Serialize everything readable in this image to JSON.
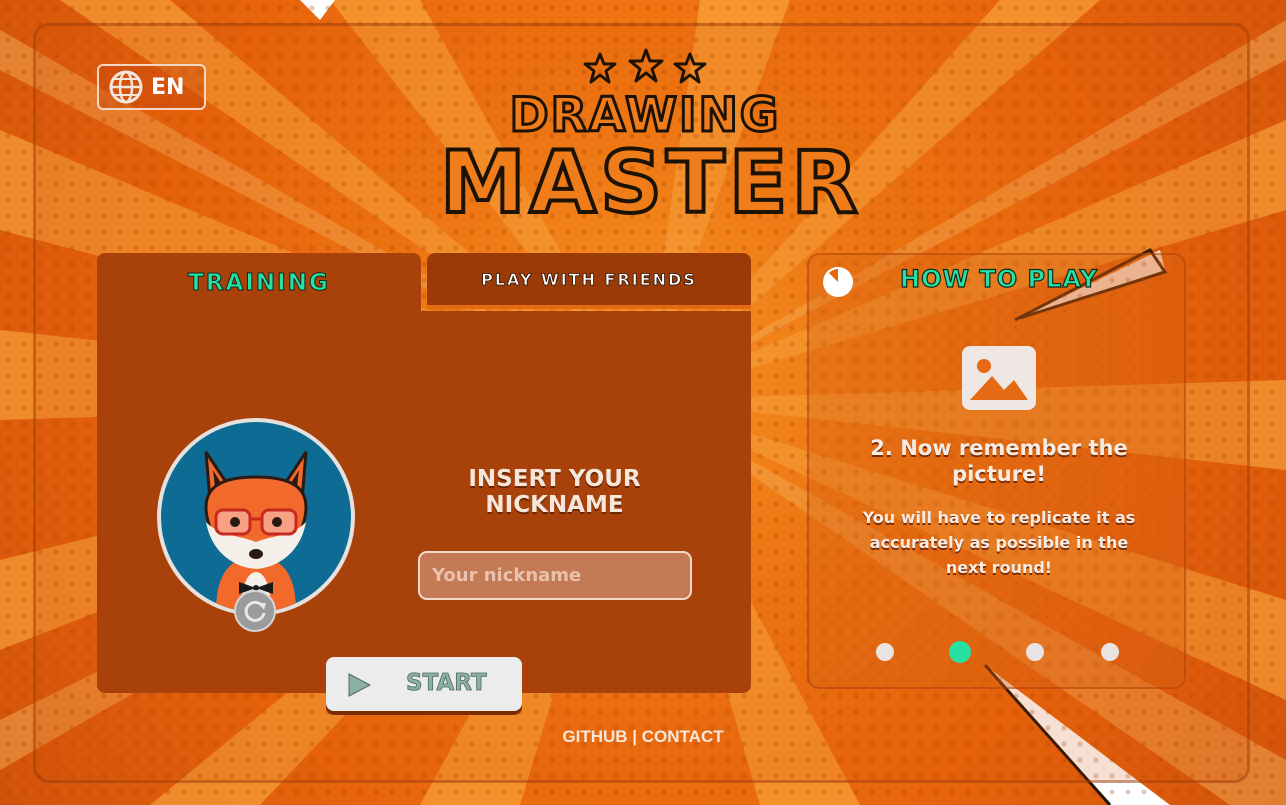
{
  "language": {
    "code": "EN",
    "icon": "globe-icon"
  },
  "logo": {
    "line1": "DRAWING",
    "line2": "MASTER",
    "stars_icon": "three-stars-icon"
  },
  "tabs": [
    {
      "label": "TRAINING",
      "active": true
    },
    {
      "label": "PLAY WITH FRIENDS",
      "active": false
    }
  ],
  "training": {
    "avatar_icon": "fox-avatar",
    "refresh_icon": "refresh-icon",
    "insert_title_line1": "INSERT YOUR",
    "insert_title_line2": "NICKNAME",
    "nickname_placeholder": "Your nickname",
    "nickname_value": "",
    "start_label": "START",
    "start_icon": "play-icon"
  },
  "how_to_play": {
    "title": "HOW TO PLAY",
    "timer_icon": "timer-icon",
    "step_icon": "image-icon",
    "step_title": "2. Now remember the picture!",
    "step_description": "You will have to replicate it as accurately as possible in the next round!",
    "total_steps": 4,
    "active_step": 2
  },
  "footer": {
    "github": "GITHUB",
    "separator": "|",
    "contact": "CONTACT"
  },
  "colors": {
    "accent": "#27e0a4",
    "panel": "#a9420a",
    "background": "#f27a12"
  }
}
